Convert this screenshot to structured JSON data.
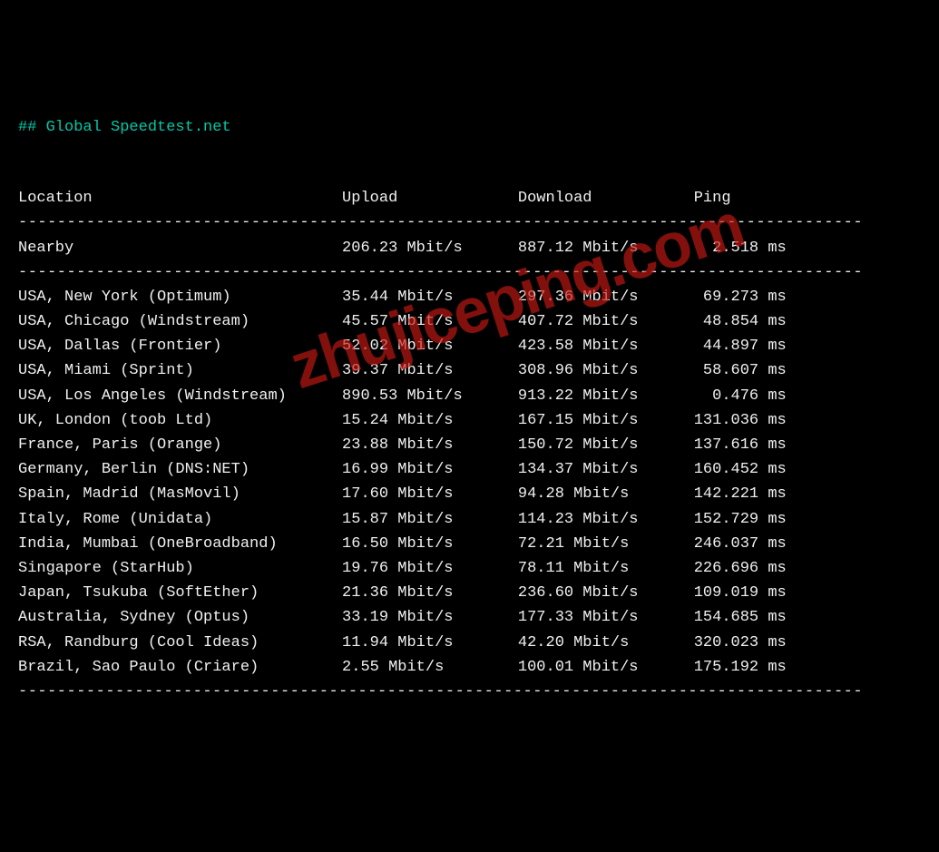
{
  "title": "## Global Speedtest.net",
  "headers": {
    "location": "Location",
    "upload": "Upload",
    "download": "Download",
    "ping": "Ping"
  },
  "unit_speed": "Mbit/s",
  "unit_ping": "ms",
  "watermark": "zhujiceping.com",
  "nearby": {
    "location": "Nearby",
    "upload": "206.23",
    "download": "887.12",
    "ping": "2.518"
  },
  "rows": [
    {
      "location": "USA, New York (Optimum)",
      "upload": "35.44",
      "download": "297.36",
      "ping": "69.273"
    },
    {
      "location": "USA, Chicago (Windstream)",
      "upload": "45.57",
      "download": "407.72",
      "ping": "48.854"
    },
    {
      "location": "USA, Dallas (Frontier)",
      "upload": "52.02",
      "download": "423.58",
      "ping": "44.897"
    },
    {
      "location": "USA, Miami (Sprint)",
      "upload": "39.37",
      "download": "308.96",
      "ping": "58.607"
    },
    {
      "location": "USA, Los Angeles (Windstream)",
      "upload": "890.53",
      "download": "913.22",
      "ping": "0.476"
    },
    {
      "location": "UK, London (toob Ltd)",
      "upload": "15.24",
      "download": "167.15",
      "ping": "131.036"
    },
    {
      "location": "France, Paris (Orange)",
      "upload": "23.88",
      "download": "150.72",
      "ping": "137.616"
    },
    {
      "location": "Germany, Berlin (DNS:NET)",
      "upload": "16.99",
      "download": "134.37",
      "ping": "160.452"
    },
    {
      "location": "Spain, Madrid (MasMovil)",
      "upload": "17.60",
      "download": "94.28",
      "ping": "142.221"
    },
    {
      "location": "Italy, Rome (Unidata)",
      "upload": "15.87",
      "download": "114.23",
      "ping": "152.729"
    },
    {
      "location": "India, Mumbai (OneBroadband)",
      "upload": "16.50",
      "download": "72.21",
      "ping": "246.037"
    },
    {
      "location": "Singapore (StarHub)",
      "upload": "19.76",
      "download": "78.11",
      "ping": "226.696"
    },
    {
      "location": "Japan, Tsukuba (SoftEther)",
      "upload": "21.36",
      "download": "236.60",
      "ping": "109.019"
    },
    {
      "location": "Australia, Sydney (Optus)",
      "upload": "33.19",
      "download": "177.33",
      "ping": "154.685"
    },
    {
      "location": "RSA, Randburg (Cool Ideas)",
      "upload": "11.94",
      "download": "42.20",
      "ping": "320.023"
    },
    {
      "location": "Brazil, Sao Paulo (Criare)",
      "upload": "2.55",
      "download": "100.01",
      "ping": "175.192"
    }
  ],
  "layout": {
    "col_loc": 35,
    "col_upl": 19,
    "col_dwn": 19,
    "col_png": 12,
    "png_num_width": 7,
    "dash_len": 87
  }
}
